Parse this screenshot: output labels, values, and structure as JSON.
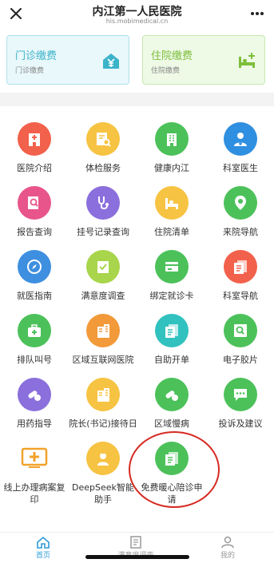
{
  "header": {
    "title": "内江第一人民医院",
    "subtitle": "his.mobimedical.cn"
  },
  "payments": [
    {
      "title": "门诊缴费",
      "subtitle": "门诊缴费"
    },
    {
      "title": "住院缴费",
      "subtitle": "住院缴费"
    }
  ],
  "services": [
    {
      "label": "医院介绍",
      "icon": "hospital-icon",
      "color": "#f2614b"
    },
    {
      "label": "体检服务",
      "icon": "document-search-icon",
      "color": "#f6c342"
    },
    {
      "label": "健康内江",
      "icon": "building-icon",
      "color": "#4cc15a"
    },
    {
      "label": "科室医生",
      "icon": "doctor-icon",
      "color": "#2f8fe0"
    },
    {
      "label": "报告查询",
      "icon": "report-search-icon",
      "color": "#e8558a"
    },
    {
      "label": "挂号记录查询",
      "icon": "stethoscope-icon",
      "color": "#8b6fdc"
    },
    {
      "label": "住院清单",
      "icon": "bed-icon",
      "color": "#f6c342"
    },
    {
      "label": "来院导航",
      "icon": "location-icon",
      "color": "#4cc15a"
    },
    {
      "label": "就医指南",
      "icon": "compass-icon",
      "color": "#3e8fe0"
    },
    {
      "label": "满意度调查",
      "icon": "checklist-icon",
      "color": "#a8d54b"
    },
    {
      "label": "绑定就诊卡",
      "icon": "card-icon",
      "color": "#4cc15a"
    },
    {
      "label": "科室导航",
      "icon": "documents-icon",
      "color": "#f2614b"
    },
    {
      "label": "排队叫号",
      "icon": "medkit-icon",
      "color": "#4cc15a"
    },
    {
      "label": "区域互联网医院",
      "icon": "building-icon",
      "color": "#f29a3a"
    },
    {
      "label": "自助开单",
      "icon": "documents-icon",
      "color": "#31c1bf"
    },
    {
      "label": "电子胶片",
      "icon": "film-icon",
      "color": "#4cc15a"
    },
    {
      "label": "用药指导",
      "icon": "pills-icon",
      "color": "#8b6fdc"
    },
    {
      "label": "院长(书记)接待日",
      "icon": "building-icon",
      "color": "#f6c342"
    },
    {
      "label": "区域慢病",
      "icon": "pills-icon",
      "color": "#4cc15a"
    },
    {
      "label": "投诉及建议",
      "icon": "chat-icon",
      "color": "#4cc15a"
    },
    {
      "label": "线上办理病案复印",
      "icon": "screen-cross-icon",
      "color": "#f2a22a"
    },
    {
      "label": "DeepSeek智能助手",
      "icon": "assistant-icon",
      "color": "#f6c342"
    },
    {
      "label": "免费暖心陪诊申请",
      "icon": "documents-icon",
      "color": "#4cc15a"
    }
  ],
  "tabs": [
    {
      "label": "首页",
      "icon": "home-icon"
    },
    {
      "label": "满意度调查",
      "icon": "survey-icon"
    },
    {
      "label": "我的",
      "icon": "user-icon"
    }
  ],
  "colors": {
    "accent": "#2c9bd6",
    "highlight_circle": "#d62a22"
  }
}
